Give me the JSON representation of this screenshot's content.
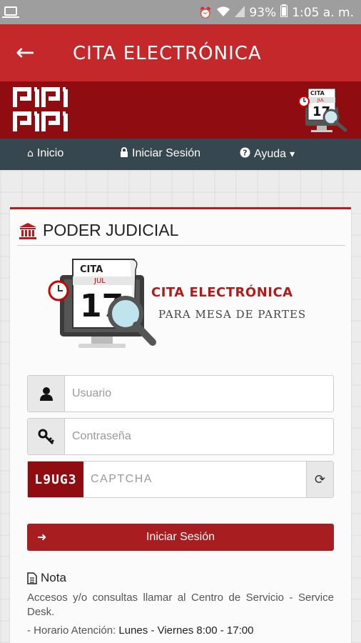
{
  "status_bar": {
    "battery": "93%",
    "time": "1:05 a. m."
  },
  "app_bar": {
    "title": "CITA ELECTRÓNICA"
  },
  "nav": {
    "items": [
      {
        "label": "Inicio",
        "icon": "home-icon"
      },
      {
        "label": "Iniciar Sesión",
        "icon": "lock-icon"
      },
      {
        "label": "Ayuda",
        "icon": "question-circle-icon"
      }
    ]
  },
  "banner_calendar": {
    "label": "CITA",
    "month": "JUL",
    "day": "17"
  },
  "card": {
    "title": "PODER JUDICIAL",
    "hero": {
      "calendar_label": "CITA",
      "month": "JUL",
      "day": "17",
      "title": "CITA ELECTRÓNICA",
      "subtitle": "PARA MESA DE PARTES"
    },
    "username": {
      "placeholder": "Usuario",
      "value": ""
    },
    "password": {
      "placeholder": "Contraseña",
      "value": ""
    },
    "captcha": {
      "code": "L9UG3",
      "placeholder": "CAPTCHA",
      "value": ""
    },
    "login_label": "Iniciar Sesión"
  },
  "note": {
    "title": "Nota",
    "text": "Accesos y/o consultas llamar al Centro de Servicio - Service Desk.",
    "hours_label": "- Horario Atención:",
    "hours_value": "Lunes - Viernes 8:00 - 17:00"
  },
  "colors": {
    "app_bar": "#c5282a",
    "banner": "#8f0d10",
    "nav": "#37474f",
    "accent": "#a81d1f"
  }
}
